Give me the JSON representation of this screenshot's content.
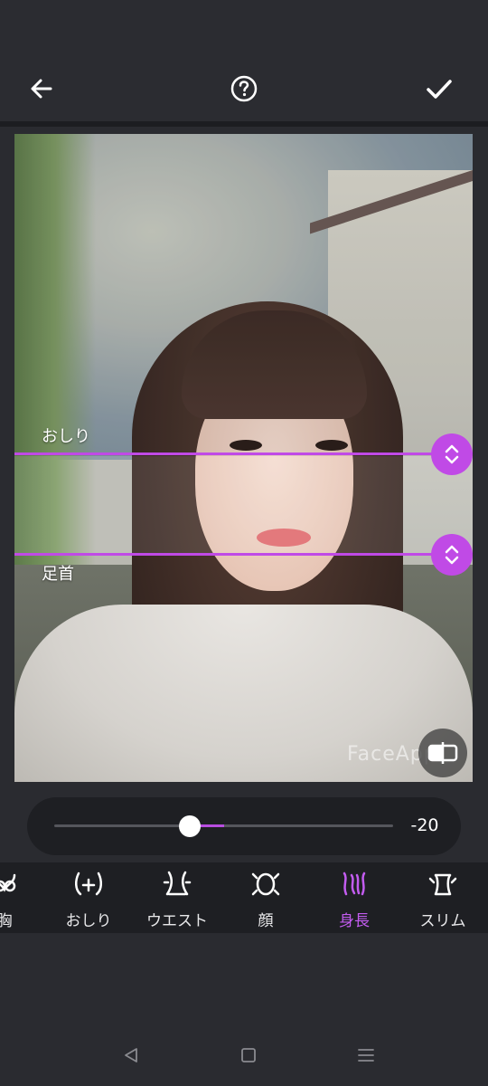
{
  "header": {
    "back_icon": "arrow-left-icon",
    "help_icon": "help-circle-icon",
    "confirm_icon": "check-icon"
  },
  "editor": {
    "guides": [
      {
        "label": "おしり"
      },
      {
        "label": "足首"
      }
    ],
    "watermark": "FaceApp",
    "compare_icon": "compare-icon",
    "accent_color": "#c04ae6"
  },
  "slider": {
    "value": "-20"
  },
  "tabs": [
    {
      "label": "胸",
      "icon": "chest-icon",
      "active": false
    },
    {
      "label": "おしり",
      "icon": "hips-icon",
      "active": false
    },
    {
      "label": "ウエスト",
      "icon": "waist-icon",
      "active": false
    },
    {
      "label": "顔",
      "icon": "face-icon",
      "active": false
    },
    {
      "label": "身長",
      "icon": "height-icon",
      "active": true
    },
    {
      "label": "スリム",
      "icon": "slim-icon",
      "active": false
    }
  ],
  "navbar": {
    "back": "nav-back-icon",
    "home": "nav-home-icon",
    "recents": "nav-recents-icon"
  }
}
